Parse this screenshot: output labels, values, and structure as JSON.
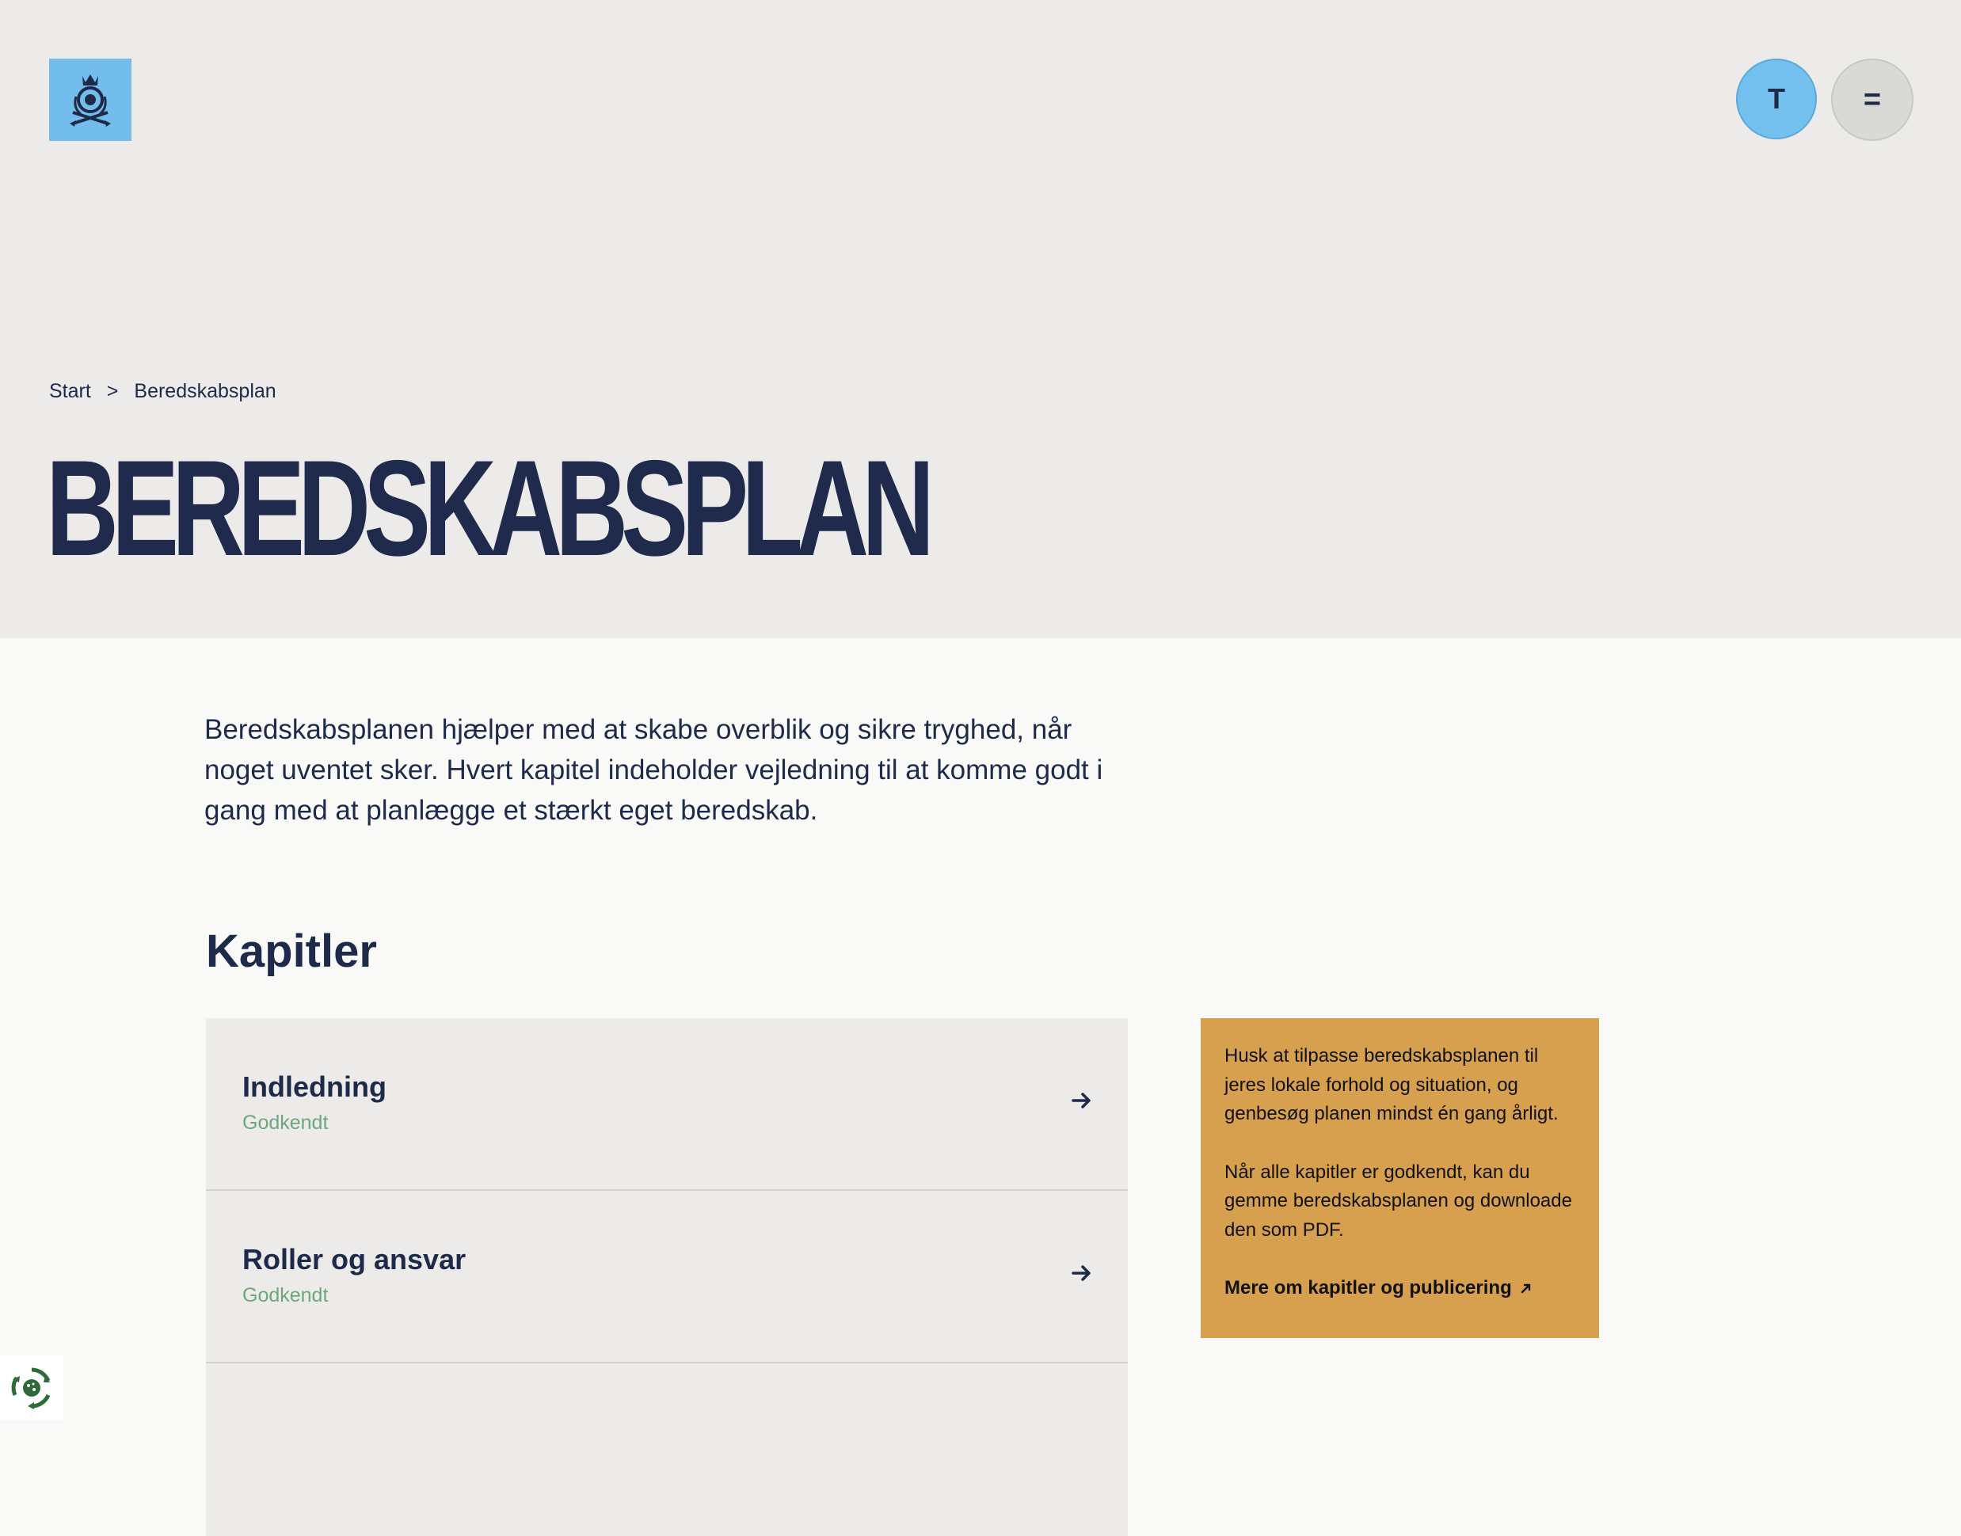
{
  "header": {
    "avatar_initial": "T",
    "menu_label": "="
  },
  "breadcrumb": {
    "home": "Start",
    "separator": ">",
    "current": "Beredskabsplan"
  },
  "page": {
    "title": "BEREDSKABSPLAN",
    "intro": "Beredskabsplanen hjælper med at skabe overblik og sikre tryghed, når noget uventet sker. Hvert kapitel indeholder vejledning til at komme godt i gang med at planlægge et stærkt eget beredskab.",
    "section_title": "Kapitler"
  },
  "chapters": [
    {
      "name": "Indledning",
      "status": "Godkendt"
    },
    {
      "name": "Roller og ansvar",
      "status": "Godkendt"
    },
    {
      "name": "",
      "status": ""
    }
  ],
  "note": {
    "paragraph1": "Husk at tilpasse beredskabsplanen til jeres lokale forhold og situation, og genbesøg planen mindst én gang årligt.",
    "paragraph2": "Når alle kapitler er godkendt, kan du gemme beredskabsplanen og downloade den som PDF.",
    "link": "Mere om kapitler og publicering"
  },
  "icons": {
    "logo": "crown-emblem-logo",
    "chapter_arrow": "arrow-right-icon",
    "external_link": "arrow-up-right-icon",
    "cookie": "cookie-settings-icon"
  },
  "colors": {
    "navy": "#1e2a4a",
    "hero_bg": "#edebe9",
    "accent_blue": "#74c0ef",
    "status_green": "#6ea67c",
    "note_bg": "#d6a04e"
  }
}
